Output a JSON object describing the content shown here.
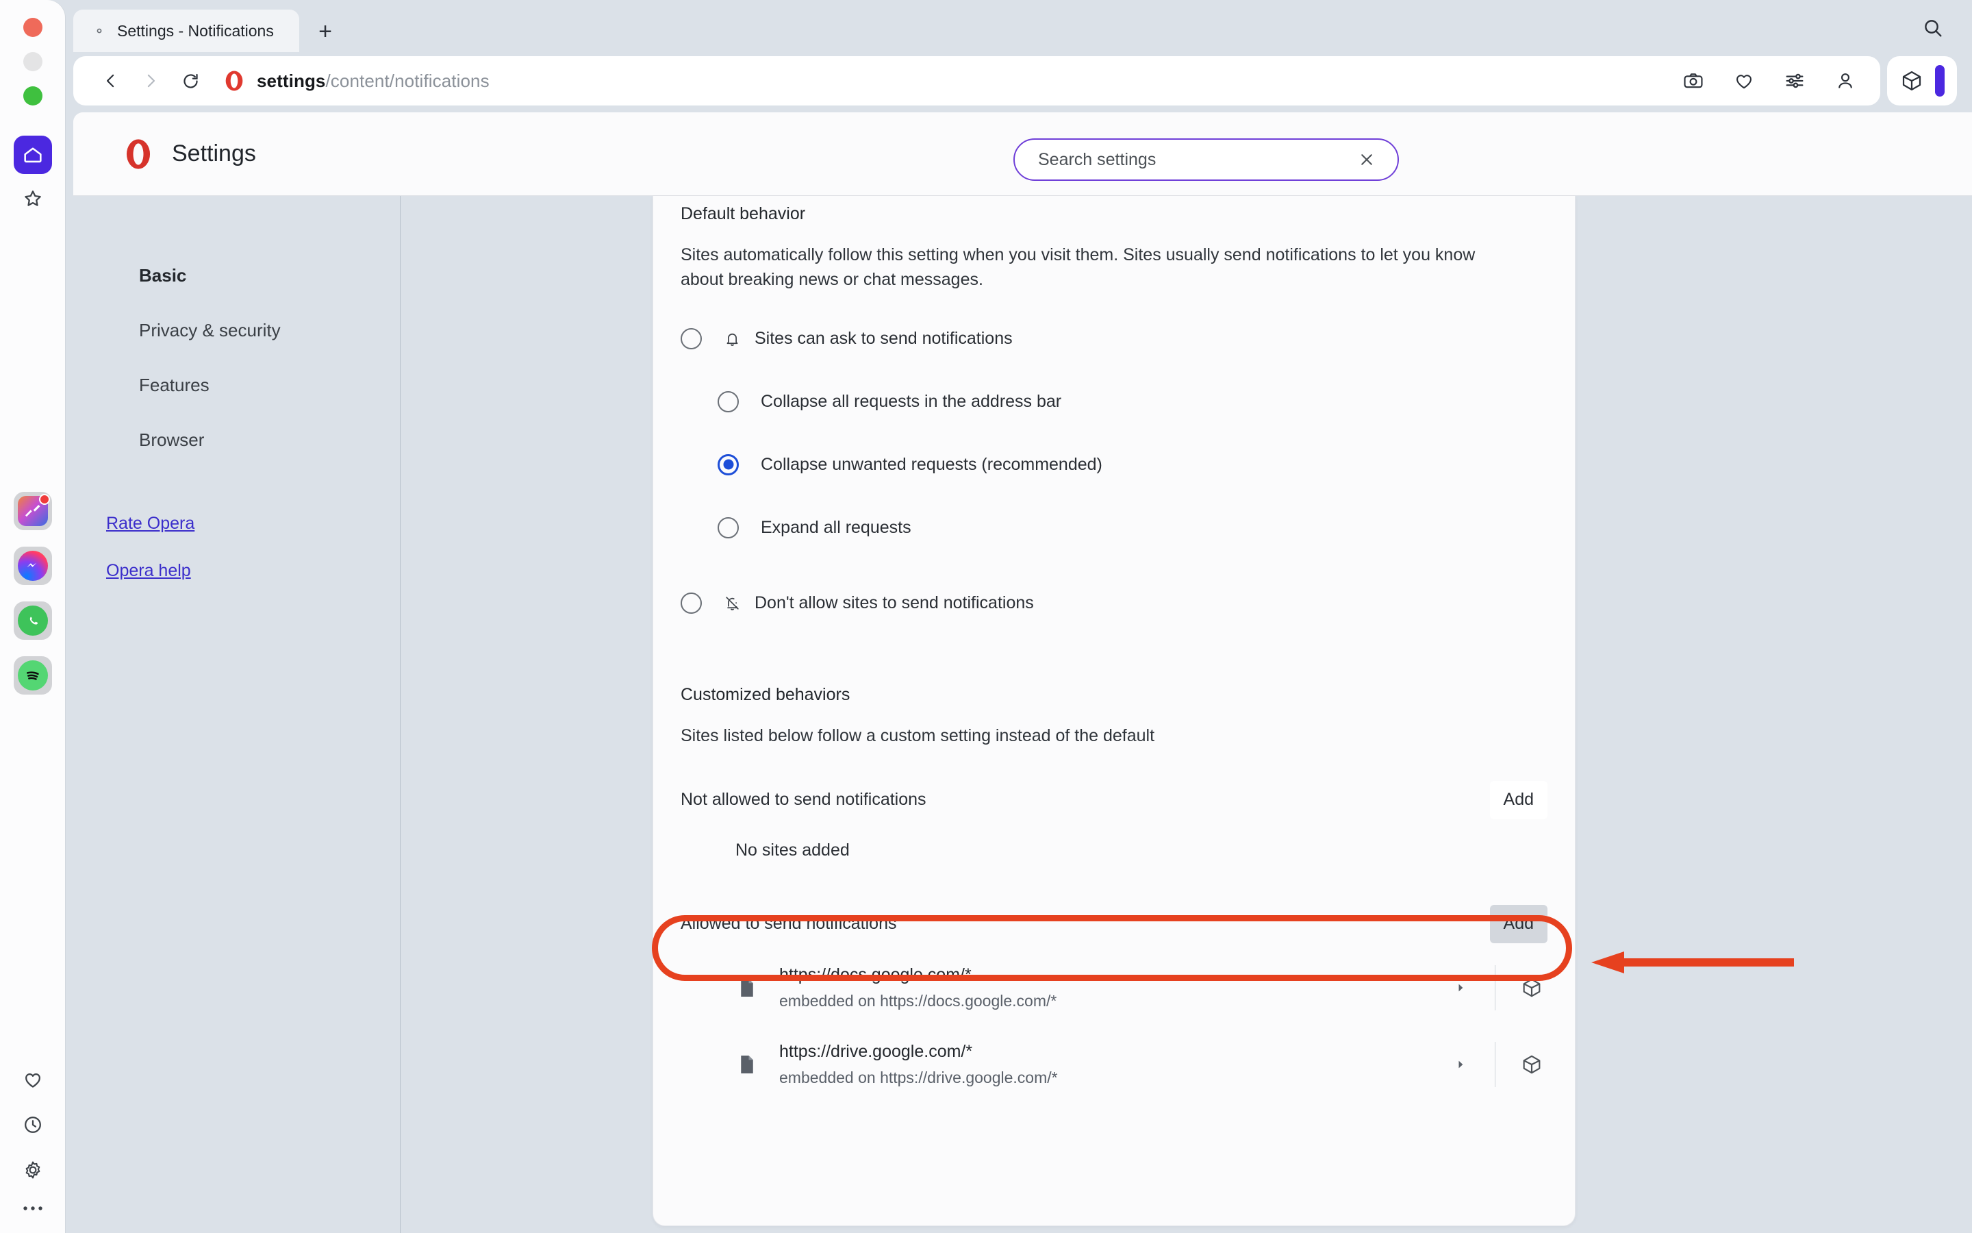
{
  "window": {
    "controls": [
      "close",
      "minimize",
      "maximize"
    ]
  },
  "tabstrip": {
    "tabs": [
      {
        "title": "Settings - Notifications",
        "favicon": "gear-icon",
        "active": true
      }
    ],
    "new_tab_label": "+",
    "search_icon": "search-icon"
  },
  "addressbar": {
    "back_icon": "chevron-left-icon",
    "forward_icon": "chevron-right-icon",
    "reload_icon": "reload-icon",
    "site_icon": "opera-logo-icon",
    "url_host": "settings",
    "url_path": "/content/notifications",
    "right_icons": [
      "camera-icon",
      "heart-icon",
      "sliders-icon",
      "person-icon"
    ],
    "extension_icon": "cube-icon",
    "indicator_color": "#4b28e0"
  },
  "sidebar": {
    "top_items": [
      {
        "name": "home-icon",
        "active": true
      },
      {
        "name": "star-icon",
        "active": false
      }
    ],
    "apps": [
      {
        "name": "pinboards-icon",
        "badge": true
      },
      {
        "name": "messenger-icon",
        "badge": false
      },
      {
        "name": "whatsapp-icon",
        "badge": false
      },
      {
        "name": "spotify-icon",
        "badge": false
      }
    ],
    "bottom_items": [
      {
        "name": "heart-icon"
      },
      {
        "name": "history-clock-icon"
      },
      {
        "name": "gear-icon"
      },
      {
        "name": "more-dots-icon"
      }
    ]
  },
  "settings_header": {
    "logo": "opera-logo-icon",
    "title": "Settings",
    "search": {
      "value": "Search settings",
      "placeholder": "Search settings",
      "clear_icon": "close-icon"
    }
  },
  "nav": {
    "items": [
      {
        "label": "Basic",
        "active": true
      },
      {
        "label": "Privacy & security",
        "active": false
      },
      {
        "label": "Features",
        "active": false
      },
      {
        "label": "Browser",
        "active": false
      }
    ],
    "links": [
      {
        "label": "Rate Opera"
      },
      {
        "label": "Opera help"
      }
    ]
  },
  "main": {
    "default_behavior": {
      "title": "Default behavior",
      "description": "Sites automatically follow this setting when you visit them. Sites usually send notifications to let you know about breaking news or chat messages.",
      "options": [
        {
          "label": "Sites can ask to send notifications",
          "icon": "bell-icon",
          "selected": false,
          "sub_options": [
            {
              "label": "Collapse all requests in the address bar",
              "selected": false
            },
            {
              "label": "Collapse unwanted requests (recommended)",
              "selected": true
            },
            {
              "label": "Expand all requests",
              "selected": false
            }
          ]
        },
        {
          "label": "Don't allow sites to send notifications",
          "icon": "bell-off-icon",
          "selected": false,
          "sub_options": []
        }
      ]
    },
    "customized_behaviors": {
      "title": "Customized behaviors",
      "description": "Sites listed below follow a custom setting instead of the default",
      "blocked": {
        "label": "Not allowed to send notifications",
        "add_label": "Add",
        "empty_label": "No sites added",
        "sites": []
      },
      "allowed": {
        "label": "Allowed to send notifications",
        "add_label": "Add",
        "sites": [
          {
            "icon": "document-icon",
            "url": "https://docs.google.com/*",
            "embedded": "embedded on https://docs.google.com/*",
            "chevron": "chevron-right-icon",
            "action_icon": "cube-icon"
          },
          {
            "icon": "document-icon",
            "url": "https://drive.google.com/*",
            "embedded": "embedded on https://drive.google.com/*",
            "chevron": "chevron-right-icon",
            "action_icon": "cube-icon"
          }
        ]
      }
    }
  },
  "annotations": {
    "highlight_color": "#e6411f",
    "highlight_target": "Allowed to send notifications",
    "arrow_direction": "left"
  }
}
